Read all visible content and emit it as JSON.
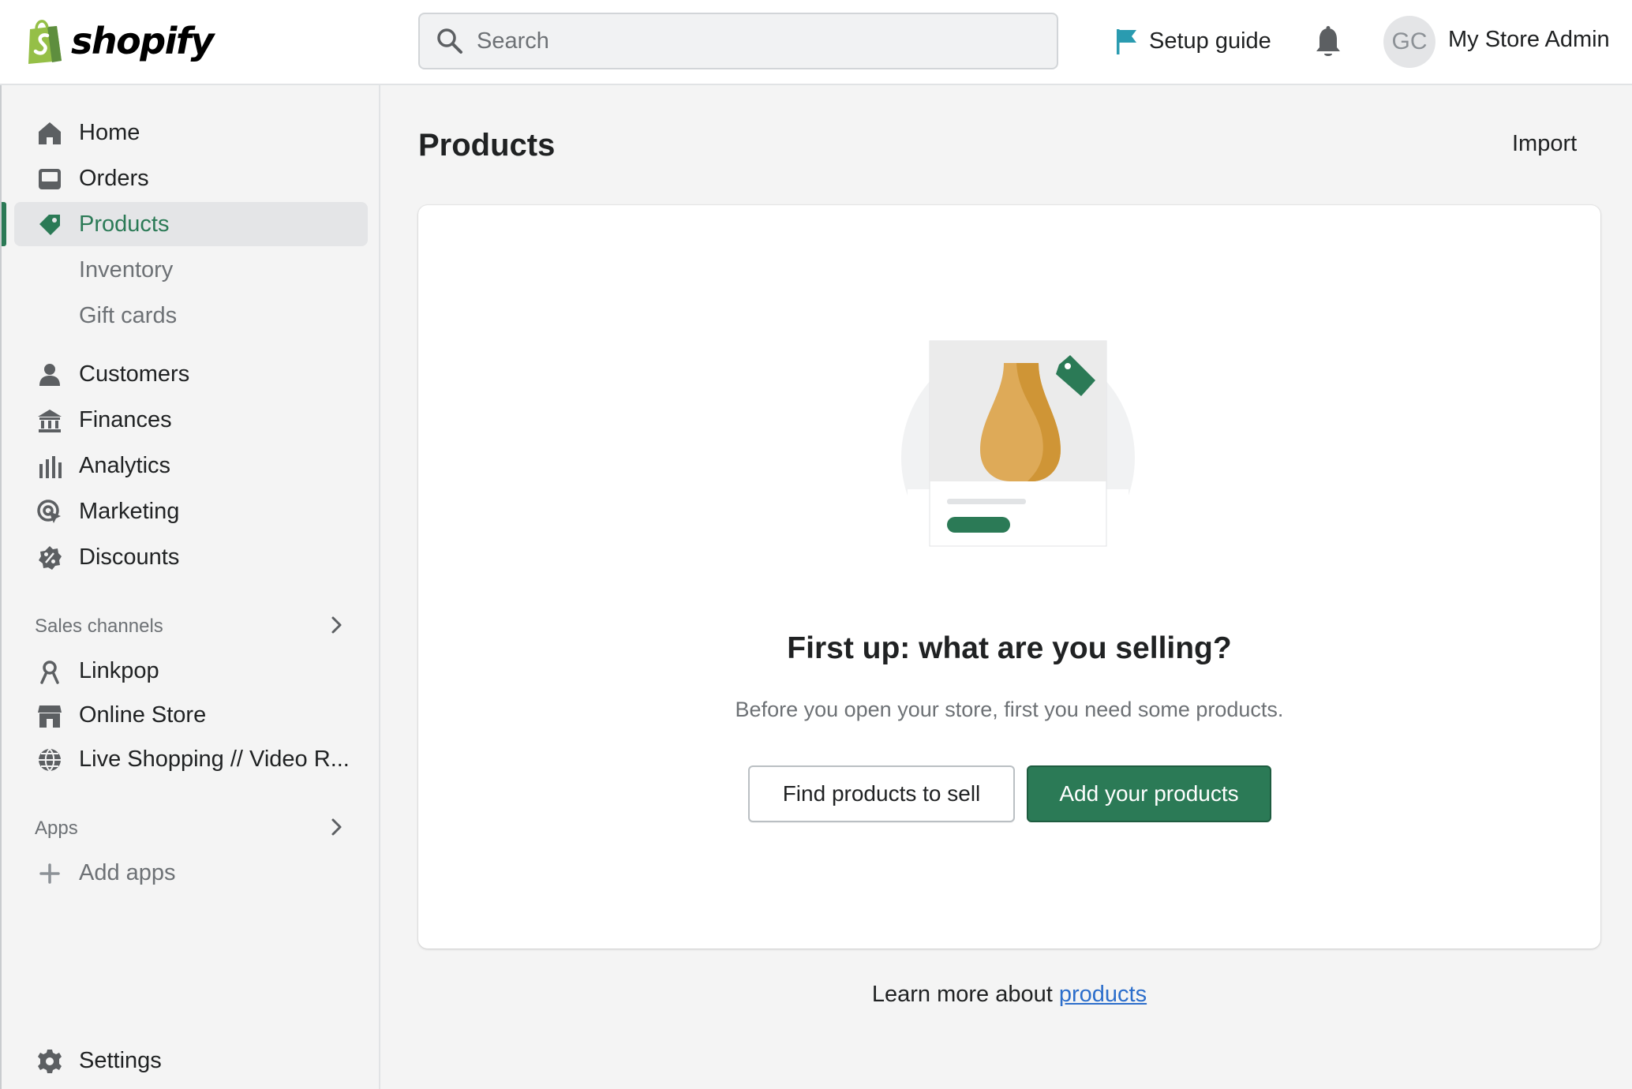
{
  "topbar": {
    "logo_text": "shopify",
    "search_placeholder": "Search",
    "setup_guide_label": "Setup guide",
    "avatar_initials": "GC",
    "store_name": "My Store Admin"
  },
  "sidebar": {
    "items": [
      {
        "label": "Home",
        "icon": "home-icon"
      },
      {
        "label": "Orders",
        "icon": "orders-icon"
      },
      {
        "label": "Products",
        "icon": "tag-icon",
        "active": true
      },
      {
        "label": "Inventory"
      },
      {
        "label": "Gift cards"
      },
      {
        "label": "Customers",
        "icon": "person-icon"
      },
      {
        "label": "Finances",
        "icon": "bank-icon"
      },
      {
        "label": "Analytics",
        "icon": "bar-chart-icon"
      },
      {
        "label": "Marketing",
        "icon": "target-icon"
      },
      {
        "label": "Discounts",
        "icon": "discount-icon"
      }
    ],
    "sales_channels_title": "Sales channels",
    "sales_channels": [
      {
        "label": "Linkpop",
        "icon": "linkpop-icon"
      },
      {
        "label": "Online Store",
        "icon": "store-icon"
      },
      {
        "label": "Live Shopping // Video R...",
        "icon": "globe-icon"
      }
    ],
    "apps_title": "Apps",
    "add_apps_label": "Add apps",
    "settings_label": "Settings"
  },
  "main": {
    "title": "Products",
    "import_label": "Import",
    "empty_state": {
      "heading": "First up: what are you selling?",
      "subtext": "Before you open your store, first you need some products.",
      "secondary_button": "Find products to sell",
      "primary_button": "Add your products"
    },
    "learn_more_prefix": "Learn more about ",
    "learn_more_link": "products"
  },
  "colors": {
    "accent": "#2b7a56",
    "link": "#2c6ecb",
    "shopify_green": "#95bf47"
  }
}
